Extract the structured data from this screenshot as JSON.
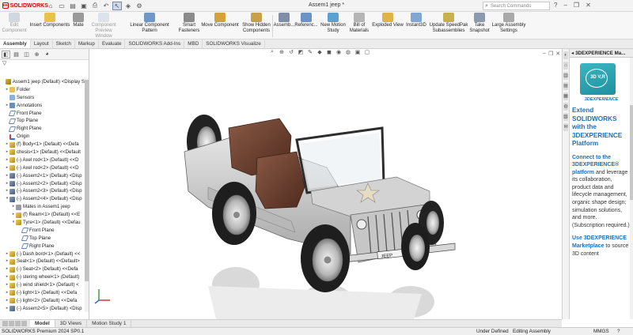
{
  "app": {
    "logo_text": "SOLIDWORKS",
    "document_title": "Assem1 jeep *"
  },
  "search": {
    "placeholder": "Search Commands"
  },
  "ribbon": {
    "edit_component": "Edit Component",
    "insert_components": "Insert Components",
    "mate": "Mate",
    "component_preview": "Component Preview Window",
    "linear_pattern": "Linear Component Pattern",
    "smart_fasteners": "Smart Fasteners",
    "move_component": "Move Component",
    "show_hidden": "Show Hidden Components",
    "assembly": "Assemb...",
    "reference": "Referenc...",
    "new_motion_study": "New Motion Study",
    "bill_of_materials": "Bill of Materials",
    "exploded_view": "Exploded View",
    "instant3d": "Instant3D",
    "speedpak": "Update SpeedPak Subassemblies",
    "take_snapshot": "Take Snapshot",
    "large_assembly": "Large Assembly Settings"
  },
  "command_tabs": [
    "Assembly",
    "Layout",
    "Sketch",
    "Markup",
    "Evaluate",
    "SOLIDWORKS Add-Ins",
    "MBD",
    "SOLIDWORKS Visualize"
  ],
  "tree": [
    {
      "label": "Assem1 jeep (Default) <Display S",
      "icon": "assembly-icon",
      "arrow": ""
    },
    {
      "label": "Folder",
      "icon": "folder-icon",
      "arrow": "▸"
    },
    {
      "label": "Sensors",
      "icon": "sensor-icon",
      "arrow": ""
    },
    {
      "label": "Annotations",
      "icon": "annotation-icon",
      "arrow": "▸"
    },
    {
      "label": "Front Plane",
      "icon": "plane-icon",
      "arrow": ""
    },
    {
      "label": "Top Plane",
      "icon": "plane-icon",
      "arrow": ""
    },
    {
      "label": "Right Plane",
      "icon": "plane-icon",
      "arrow": ""
    },
    {
      "label": "Origin",
      "icon": "origin-icon",
      "arrow": ""
    },
    {
      "label": "(f) Body<1> (Default) <<Defa",
      "icon": "part-icon",
      "arrow": "▸"
    },
    {
      "label": "chesis<1> (Default) <<Default",
      "icon": "part-icon",
      "arrow": "▸"
    },
    {
      "label": "(-) Axel rod<1> (Default) <<D",
      "icon": "part-icon",
      "arrow": "▸"
    },
    {
      "label": "(-) Axel rod<2> (Default) <<D",
      "icon": "part-icon",
      "arrow": "▸"
    },
    {
      "label": "(-) Assem2<1> (Default) <Disp",
      "icon": "subassembly-icon",
      "arrow": "▸"
    },
    {
      "label": "(-) Assem2<2> (Default) <Disp",
      "icon": "subassembly-icon",
      "arrow": "▸"
    },
    {
      "label": "(-) Assem2<3> (Default) <Disp",
      "icon": "subassembly-icon",
      "arrow": "▸"
    },
    {
      "label": "(-) Assem2<4> (Default) <Disp",
      "icon": "subassembly-icon",
      "arrow": "▾"
    },
    {
      "label": "Mates in Assem1 jeep",
      "icon": "mate-icon",
      "arrow": "▸",
      "indent": 1
    },
    {
      "label": "(f) Ream<1> (Default) <<E",
      "icon": "part-icon",
      "arrow": "▸",
      "indent": 1
    },
    {
      "label": "Tyre<1> (Default) <<Defau",
      "icon": "part-icon",
      "arrow": "▾",
      "indent": 1
    },
    {
      "label": "Front Plane",
      "icon": "plane-icon",
      "arrow": "",
      "indent": 2
    },
    {
      "label": "Top Plane",
      "icon": "plane-icon",
      "arrow": "",
      "indent": 2
    },
    {
      "label": "Right Plane",
      "icon": "plane-icon",
      "arrow": "",
      "indent": 2
    },
    {
      "label": "(-) Dash bord<1> (Default) <<",
      "icon": "part-icon",
      "arrow": "▸"
    },
    {
      "label": "Seat<1> (Default) <<Default>",
      "icon": "part-icon",
      "arrow": "▸"
    },
    {
      "label": "(-) Seat<2> (Default) <<Defa",
      "icon": "part-icon",
      "arrow": "▸"
    },
    {
      "label": "(-) stering wheel<1> (Default)",
      "icon": "part-icon",
      "arrow": "▸"
    },
    {
      "label": "(-) wind shield<1> (Default) <",
      "icon": "part-icon",
      "arrow": "▸"
    },
    {
      "label": "(-) light<1> (Default) <<Defa",
      "icon": "part-icon",
      "arrow": "▸"
    },
    {
      "label": "(-) light<2> (Default) <<Defa",
      "icon": "part-icon",
      "arrow": "▸"
    },
    {
      "label": "(-) Assem2<5> (Default) <Disp",
      "icon": "subassembly-icon",
      "arrow": "▸"
    }
  ],
  "task_pane": {
    "header": "3DEXPERIENCE Ma...",
    "logo_text": "3D V,R",
    "brand": "3DEXPERIENCE",
    "title": "Extend SOLIDWORKS with the 3DEXPERIENCE Platform",
    "p1_lead": "Connect to the 3DEXPERIENCE® platform",
    "p1_rest": " and leverage its collaboration, product data and lifecycle management, organic shape design; simulation solutions, and more. (Subscription required.)",
    "p2_lead": "Use 3DEXPERIENCE Marketplace",
    "p2_rest": " to source 3D content"
  },
  "bottom_tabs": [
    "Model",
    "3D Views",
    "Motion Study 1"
  ],
  "status": {
    "product": "SOLIDWORKS Premium 2024 SP0.1",
    "state": "Under Defined",
    "mode": "Editing Assembly",
    "units": "MMGS"
  },
  "viewport": {
    "plate_text": "JEEP"
  },
  "colors": {
    "accent": "#1f6fb8",
    "brand_red": "#d40000",
    "body": "#c9c9c9",
    "seat": "#6b3a2a",
    "task_pane_logo": "#2aa7b5"
  }
}
